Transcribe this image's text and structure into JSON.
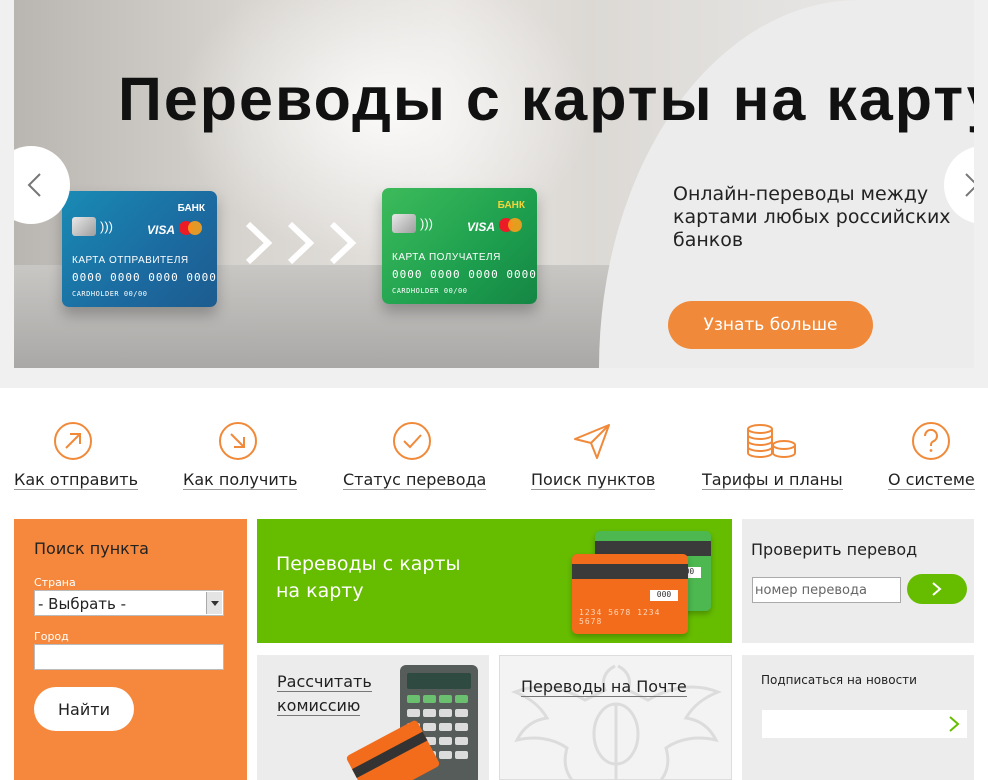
{
  "banner": {
    "title": "Переводы с карты на карту",
    "subtitle": "Онлайн-переводы между картами любых российских банков",
    "cta_label": "Узнать больше",
    "sender_card": {
      "bank": "БАНК",
      "brand": "VISA",
      "label": "КАРТА ОТПРАВИТЕЛЯ",
      "number": "0000 0000 0000 0000",
      "holder": "CARDHOLDER  00/00"
    },
    "receiver_card": {
      "bank": "БАНК",
      "brand": "VISA",
      "label": "КАРТА ПОЛУЧАТЕЛЯ",
      "number": "0000 0000 0000 0000",
      "holder": "CARDHOLDER  00/00"
    }
  },
  "nav": {
    "items": [
      {
        "label": "Как отправить",
        "icon": "arrow-up-right-circle-icon"
      },
      {
        "label": "Как получить",
        "icon": "arrow-down-right-circle-icon"
      },
      {
        "label": "Статус перевода",
        "icon": "check-circle-icon"
      },
      {
        "label": "Поиск пунктов",
        "icon": "paper-plane-icon"
      },
      {
        "label": "Тарифы и планы",
        "icon": "coins-icon"
      },
      {
        "label": "О системе",
        "icon": "question-circle-icon"
      }
    ]
  },
  "search_tile": {
    "title": "Поиск пункта",
    "country_label": "Страна",
    "country_value": "- Выбрать -",
    "city_label": "Город",
    "city_value": "",
    "find_label": "Найти"
  },
  "c2c_tile": {
    "line1": "Переводы с карты",
    "line2": "на карту",
    "cvv": "000",
    "card_number": "1234 5678 1234 5678"
  },
  "check_tile": {
    "title": "Проверить перевод",
    "placeholder": "номер перевода"
  },
  "calc_tile": {
    "line1": "Рассчитать",
    "line2": "комиссию"
  },
  "post_tile": {
    "label": "Переводы на Почте"
  },
  "news_tile": {
    "title": "Подписаться на новости"
  },
  "colors": {
    "accent_orange": "#f5883c",
    "accent_green": "#66bd00",
    "tile_gray": "#ececec"
  }
}
